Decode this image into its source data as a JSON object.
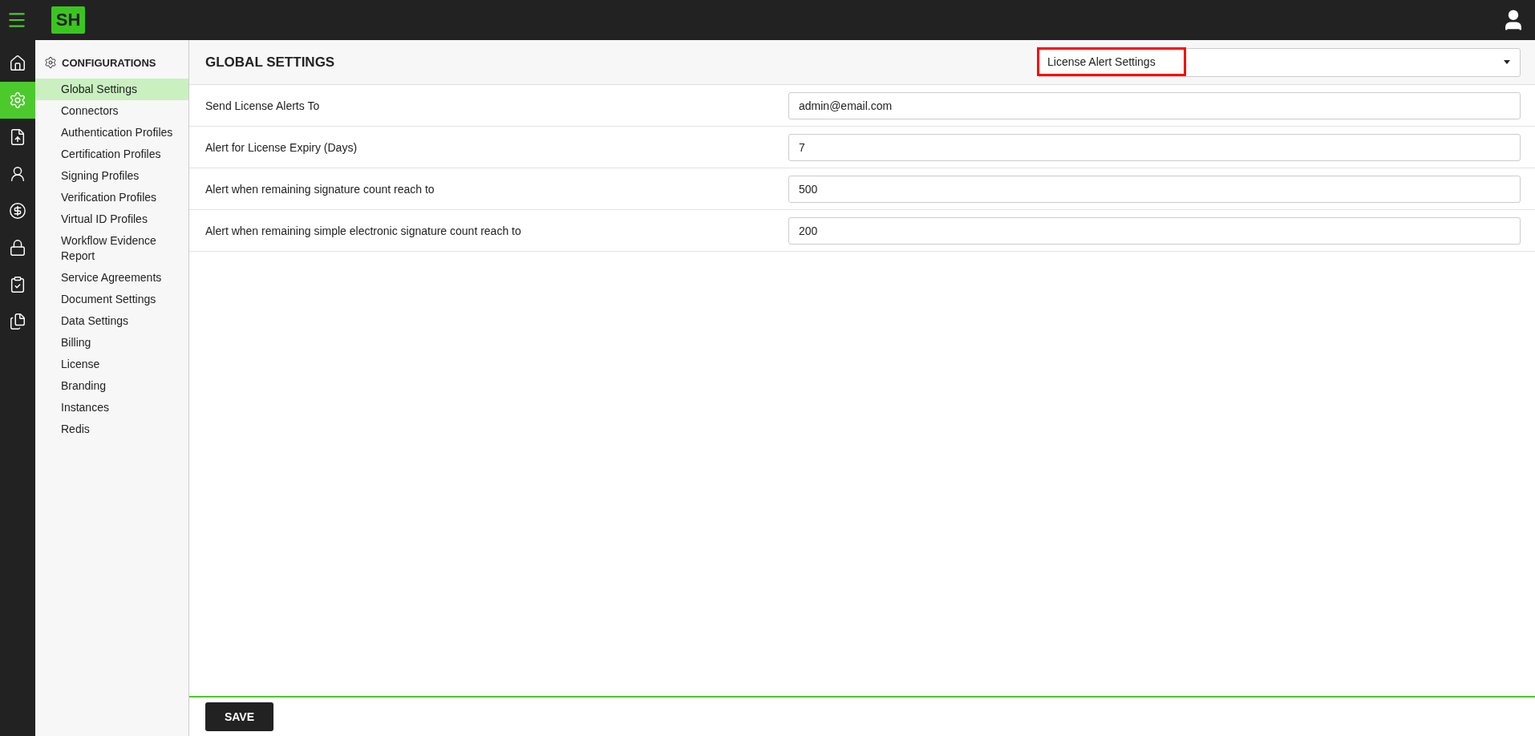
{
  "topbar": {
    "logo": "SH"
  },
  "rail": [
    {
      "kind": "home",
      "selected": false
    },
    {
      "kind": "settings",
      "selected": true
    },
    {
      "kind": "upload",
      "selected": false
    },
    {
      "kind": "user",
      "selected": false
    },
    {
      "kind": "dollar",
      "selected": false
    },
    {
      "kind": "lock",
      "selected": false
    },
    {
      "kind": "clipboard",
      "selected": false
    },
    {
      "kind": "document",
      "selected": false
    }
  ],
  "sidebar": {
    "title": "CONFIGURATIONS",
    "items": [
      {
        "label": "Global Settings",
        "selected": true
      },
      {
        "label": "Connectors",
        "selected": false
      },
      {
        "label": "Authentication Profiles",
        "selected": false
      },
      {
        "label": "Certification Profiles",
        "selected": false
      },
      {
        "label": "Signing Profiles",
        "selected": false
      },
      {
        "label": "Verification Profiles",
        "selected": false
      },
      {
        "label": "Virtual ID Profiles",
        "selected": false
      },
      {
        "label": "Workflow Evidence Report",
        "selected": false
      },
      {
        "label": "Service Agreements",
        "selected": false
      },
      {
        "label": "Document Settings",
        "selected": false
      },
      {
        "label": "Data Settings",
        "selected": false
      },
      {
        "label": "Billing",
        "selected": false
      },
      {
        "label": "License",
        "selected": false
      },
      {
        "label": "Branding",
        "selected": false
      },
      {
        "label": "Instances",
        "selected": false
      },
      {
        "label": "Redis",
        "selected": false
      }
    ]
  },
  "page": {
    "title": "GLOBAL SETTINGS",
    "section_select": {
      "value": "License Alert Settings",
      "highlighted": true
    }
  },
  "fields": [
    {
      "label": "Send License Alerts To",
      "value": "admin@email.com"
    },
    {
      "label": "Alert for License Expiry (Days)",
      "value": "7"
    },
    {
      "label": "Alert when remaining signature count reach to",
      "value": "500"
    },
    {
      "label": "Alert when remaining simple electronic signature count reach to",
      "value": "200"
    }
  ],
  "footer": {
    "save": "SAVE"
  }
}
